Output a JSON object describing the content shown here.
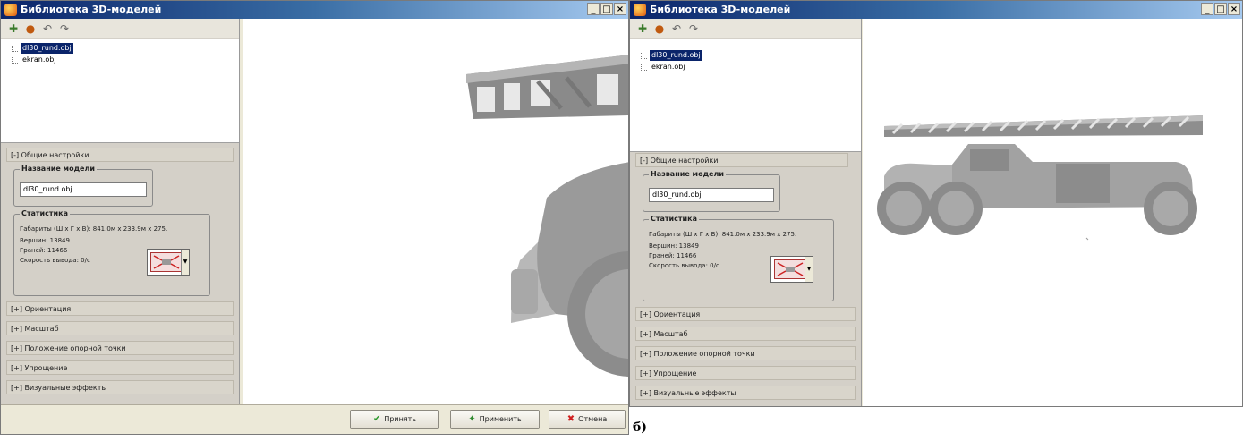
{
  "caption": "б)",
  "panels": [
    {
      "title": "Библиотека 3D-моделей",
      "window_controls": [
        "_",
        "□",
        "×"
      ],
      "tree": [
        {
          "label": "dl30_rund.obj",
          "selected": true
        },
        {
          "label": "ekran.obj",
          "selected": false
        }
      ],
      "general": {
        "header": "[-] Общие настройки",
        "model_name_legend": "Название модели",
        "model_name_value": "dl30_rund.obj",
        "stats_legend": "Статистика",
        "dims": "Габариты (Ш х Г х В):  841.0м х 233.9м х 275.",
        "vertices": "Вершин:  13849",
        "faces": "Граней:  11466",
        "speed": "Скорость вывода:  0/с"
      },
      "sections": [
        "[+] Ориентация",
        "[+] Масштаб",
        "[+] Положение опорной точки",
        "[+] Упрощение",
        "[+] Визуальные эффекты"
      ],
      "buttons": {
        "ok": "Принять",
        "apply": "Применить",
        "cancel": "Отмена"
      }
    },
    {
      "title": "Библиотека 3D-моделей",
      "window_controls": [
        "_",
        "□",
        "×"
      ],
      "tree": [
        {
          "label": "dl30_rund.obj",
          "selected": true
        },
        {
          "label": "ekran.obj",
          "selected": false
        }
      ],
      "general": {
        "header": "[-] Общие настройки",
        "model_name_legend": "Название модели",
        "model_name_value": "dl30_rund.obj",
        "stats_legend": "Статистика",
        "dims": "Габариты (Ш х Г х В):  841.0м х 233.9м х 275.",
        "vertices": "Вершин:  13849",
        "faces": "Граней:  11466",
        "speed": "Скорость вывода:  0/с"
      },
      "sections": [
        "[+] Ориентация",
        "[+] Масштаб",
        "[+] Положение опорной точки",
        "[+] Упрощение",
        "[+] Визуальные эффекты"
      ]
    }
  ]
}
